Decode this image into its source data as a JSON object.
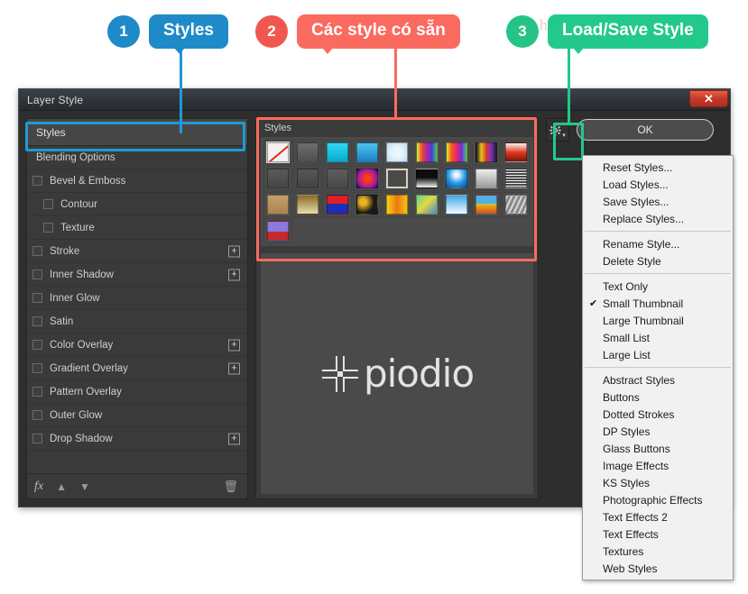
{
  "watermark": {
    "url_text": "https://phanmemgoc.com",
    "logo_text": "piodio"
  },
  "callouts": [
    {
      "number": "1",
      "label": "Styles",
      "color": "#1e8bc8"
    },
    {
      "number": "2",
      "label": "Các style có sẵn",
      "color": "#fb6a5f"
    },
    {
      "number": "3",
      "label": "Load/Save Style",
      "color": "#23c98a"
    }
  ],
  "dialog": {
    "title": "Layer Style",
    "close_label": "✕",
    "ok_label": "OK",
    "gear_icon": "gear-icon",
    "gear_caret": "▾"
  },
  "effects_panel": {
    "header": "Styles",
    "rows": [
      {
        "label": "Blending Options",
        "checkbox": false,
        "indent": false,
        "plus": false
      },
      {
        "label": "Bevel & Emboss",
        "checkbox": true,
        "indent": false,
        "plus": false
      },
      {
        "label": "Contour",
        "checkbox": true,
        "indent": true,
        "plus": false
      },
      {
        "label": "Texture",
        "checkbox": true,
        "indent": true,
        "plus": false
      },
      {
        "label": "Stroke",
        "checkbox": true,
        "indent": false,
        "plus": true
      },
      {
        "label": "Inner Shadow",
        "checkbox": true,
        "indent": false,
        "plus": true
      },
      {
        "label": "Inner Glow",
        "checkbox": true,
        "indent": false,
        "plus": false
      },
      {
        "label": "Satin",
        "checkbox": true,
        "indent": false,
        "plus": false
      },
      {
        "label": "Color Overlay",
        "checkbox": true,
        "indent": false,
        "plus": true
      },
      {
        "label": "Gradient Overlay",
        "checkbox": true,
        "indent": false,
        "plus": true
      },
      {
        "label": "Pattern Overlay",
        "checkbox": true,
        "indent": false,
        "plus": false
      },
      {
        "label": "Outer Glow",
        "checkbox": true,
        "indent": false,
        "plus": false
      },
      {
        "label": "Drop Shadow",
        "checkbox": true,
        "indent": false,
        "plus": true
      }
    ],
    "toolbar": {
      "fx_label": "fx",
      "fx_caret": "▾",
      "up_icon": "▲",
      "down_icon": "▼",
      "trash_icon": "🗑"
    }
  },
  "styles_panel": {
    "label": "Styles",
    "selected_index": 0,
    "swatches": [
      {
        "name": "none",
        "css": "none"
      },
      {
        "name": "basic-drop-shadow",
        "css": "linear-gradient(to bottom, #6e6e6e, #4f4f4f)"
      },
      {
        "name": "cyan-fill",
        "css": "linear-gradient(to bottom, #2fd8f2, #0aa9cf)"
      },
      {
        "name": "blue-button",
        "css": "linear-gradient(to bottom, #4fc4ef, #1d7fc4)"
      },
      {
        "name": "pale-blue-glow",
        "css": "radial-gradient(circle, #eaf6fd 35%, #b8dcf0 100%)"
      },
      {
        "name": "rainbow-vertical",
        "css": "linear-gradient(to right, #f2e43c, #e8531f, #b324a8, #4b3fd0, #36c27a)"
      },
      {
        "name": "rainbow-stripes",
        "css": "linear-gradient(to right, #f0e02a, #ef5f1e, #e6266e, #7b2bd4, #2fc97a)"
      },
      {
        "name": "spectrum-dark",
        "css": "linear-gradient(to right, #1a1a1a, #e9c21e, #d8392a, #7a2fc4, #1f1f1f)"
      },
      {
        "name": "red-white-fade",
        "css": "linear-gradient(to bottom, #fdf2ef, #e23a22, #7a1408)"
      },
      {
        "name": "grey-soft-1",
        "css": "linear-gradient(to bottom, #5a5a5a, #464646)"
      },
      {
        "name": "grey-soft-2",
        "css": "linear-gradient(to bottom, #565656, #434343)"
      },
      {
        "name": "grey-soft-3",
        "css": "linear-gradient(to bottom, #5e5e5e, #4a4a4a)"
      },
      {
        "name": "red-orb",
        "css": "radial-gradient(circle, #ff3d12 18%, #a11a9e 70%, #1a0b55 100%)"
      },
      {
        "name": "beige-frame",
        "css": "linear-gradient(to bottom, #4a4a4a, #4a4a4a)"
      },
      {
        "name": "black-white-fold",
        "css": "linear-gradient(to bottom, #0d0d0d 45%, #f4f4f4 100%)"
      },
      {
        "name": "blue-sphere",
        "css": "radial-gradient(circle at 50% 30%, #eaf7ff 12%, #2196e8 55%, #0a4e8c 100%)"
      },
      {
        "name": "silver-gradient",
        "css": "linear-gradient(to bottom, #eeeeee, #9a9a9a)"
      },
      {
        "name": "line-texture",
        "css": "repeating-linear-gradient(to bottom, #efefef 0 1px, #4a4a4a 1px 3px)"
      },
      {
        "name": "tan-flat",
        "css": "linear-gradient(to bottom, #c4a06a, #a8844f)"
      },
      {
        "name": "gold-cream",
        "css": "linear-gradient(to bottom, #8a6a20, #e8dcb4)"
      },
      {
        "name": "red-blue-stripe",
        "css": "linear-gradient(to bottom, #e02020 0 45%, #1a2fb4 45% 100%)"
      },
      {
        "name": "confetti-splatter",
        "css": "radial-gradient(circle at 30% 35%, #e8b420 18%, #1a1a1a 60%), radial-gradient(circle at 70% 60%, #d8342a 20%, #262626 70%)"
      },
      {
        "name": "yellow-orange",
        "css": "linear-gradient(to right, #f7d018, #e87a10, #f7c018)"
      },
      {
        "name": "green-blue-blend",
        "css": "linear-gradient(135deg, #4fd4a8, #e8d83c 45%, #3a8ad4)"
      },
      {
        "name": "sky-white-fade",
        "css": "linear-gradient(to bottom, #3fa8e8, #f4fbff)"
      },
      {
        "name": "blue-gold-bar",
        "css": "linear-gradient(to bottom, #4fb0ea 45%, #e8c020 45%, #d84a18)"
      },
      {
        "name": "metal-scratch",
        "css": "repeating-linear-gradient(115deg, #d8d8d8 0 2px, #8a8a8a 2px 5px)"
      },
      {
        "name": "purple-red-block",
        "css": "linear-gradient(to bottom, #8a7ae0 55%, #c42a2a 55%)"
      }
    ]
  },
  "context_menu": {
    "groups": [
      {
        "items": [
          {
            "label": "Reset Styles...",
            "checked": false
          },
          {
            "label": "Load Styles...",
            "checked": false
          },
          {
            "label": "Save Styles...",
            "checked": false
          },
          {
            "label": "Replace Styles...",
            "checked": false
          }
        ]
      },
      {
        "items": [
          {
            "label": "Rename Style...",
            "checked": false
          },
          {
            "label": "Delete Style",
            "checked": false
          }
        ]
      },
      {
        "items": [
          {
            "label": "Text Only",
            "checked": false
          },
          {
            "label": "Small Thumbnail",
            "checked": true
          },
          {
            "label": "Large Thumbnail",
            "checked": false
          },
          {
            "label": "Small List",
            "checked": false
          },
          {
            "label": "Large List",
            "checked": false
          }
        ]
      },
      {
        "items": [
          {
            "label": "Abstract Styles",
            "checked": false
          },
          {
            "label": "Buttons",
            "checked": false
          },
          {
            "label": "Dotted Strokes",
            "checked": false
          },
          {
            "label": "DP Styles",
            "checked": false
          },
          {
            "label": "Glass Buttons",
            "checked": false
          },
          {
            "label": "Image Effects",
            "checked": false
          },
          {
            "label": "KS Styles",
            "checked": false
          },
          {
            "label": "Photographic Effects",
            "checked": false
          },
          {
            "label": "Text Effects 2",
            "checked": false
          },
          {
            "label": "Text Effects",
            "checked": false
          },
          {
            "label": "Textures",
            "checked": false
          },
          {
            "label": "Web Styles",
            "checked": false
          }
        ]
      }
    ],
    "check_glyph": "✔"
  }
}
